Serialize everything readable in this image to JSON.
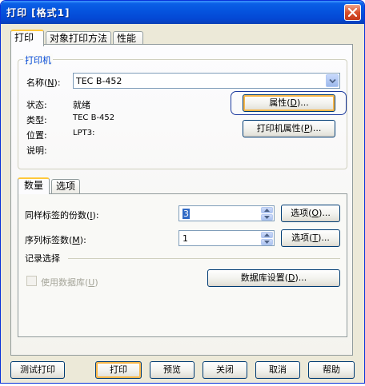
{
  "window": {
    "title": "打印 [格式1]"
  },
  "tabs": [
    {
      "label": "打印"
    },
    {
      "label": "对象打印方法"
    },
    {
      "label": "性能"
    }
  ],
  "printer": {
    "group_label": "打印机",
    "name_label_prefix": "名称(",
    "name_label_key": "N",
    "name_label_suffix": "):",
    "name_value": "TEC B-452",
    "status_label": "状态:",
    "status_value": "就绪",
    "type_label": "类型:",
    "type_value": "TEC B-452",
    "location_label": "位置:",
    "location_value": "LPT3:",
    "comment_label": "说明:",
    "properties_prefix": "属性(",
    "properties_key": "D",
    "properties_suffix": ")...",
    "printer_props_prefix": "打印机属性(",
    "printer_props_key": "P",
    "printer_props_suffix": ")..."
  },
  "inner_tabs": [
    {
      "label": "数量"
    },
    {
      "label": "选项"
    }
  ],
  "quantity": {
    "copies_prefix": "同样标签的份数(",
    "copies_key": "I",
    "copies_suffix": "):",
    "copies_value": "3",
    "copies_options_prefix": "选项(",
    "copies_options_key": "O",
    "copies_options_suffix": ")...",
    "serial_prefix": "序列标签数(",
    "serial_key": "M",
    "serial_suffix": "):",
    "serial_value": "1",
    "serial_options_prefix": "选项(",
    "serial_options_key": "T",
    "serial_options_suffix": ")...",
    "records_label": "记录选择",
    "use_db_prefix": "使用数据库(",
    "use_db_key": "U",
    "use_db_suffix": ")",
    "db_settings_prefix": "数据库设置(",
    "db_settings_key": "D",
    "db_settings_suffix": ")..."
  },
  "footer": {
    "test_print": "测试打印",
    "print": "打印",
    "preview": "预览",
    "close": "关闭",
    "cancel": "取消",
    "help": "帮助"
  },
  "colors": {
    "titlebar": "#0553de",
    "group_label": "#0046d5",
    "focus": "#f9b74a"
  }
}
